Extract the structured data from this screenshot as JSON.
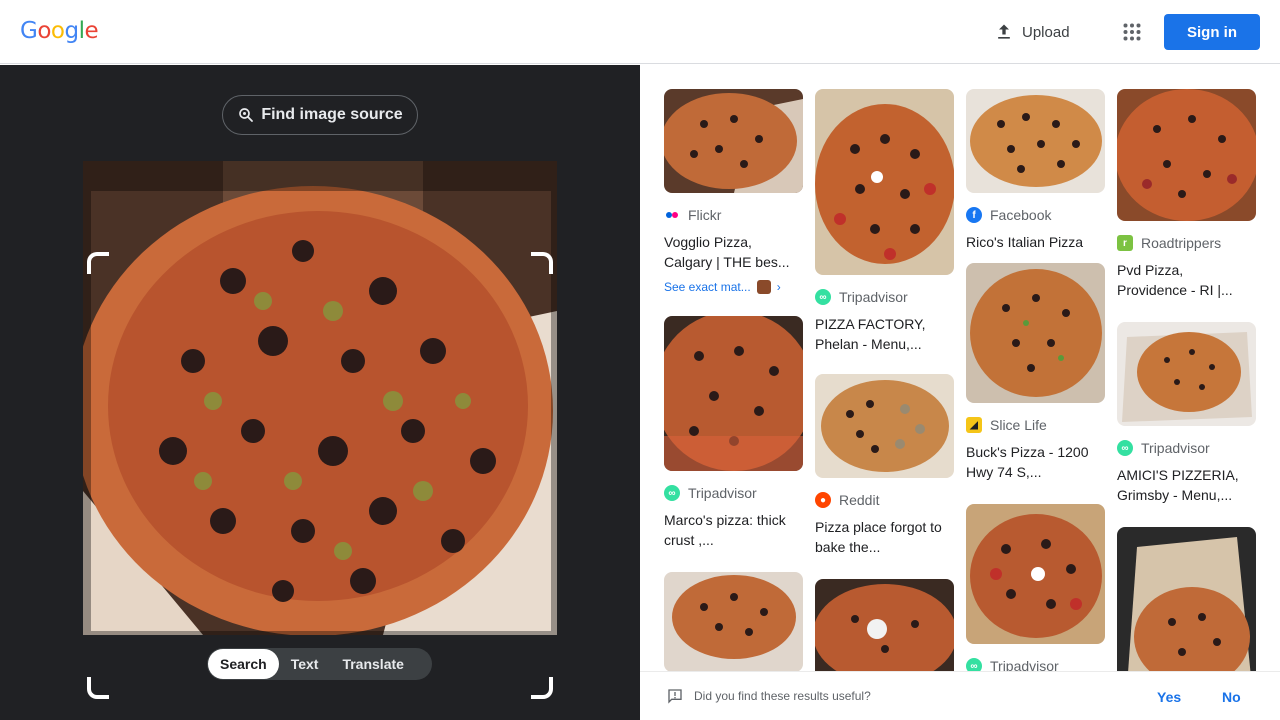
{
  "header": {
    "logo_letters": [
      {
        "ch": "G",
        "color": "#4285F4"
      },
      {
        "ch": "o",
        "color": "#EA4335"
      },
      {
        "ch": "o",
        "color": "#FBBC05"
      },
      {
        "ch": "g",
        "color": "#4285F4"
      },
      {
        "ch": "l",
        "color": "#34A853"
      },
      {
        "ch": "e",
        "color": "#EA4335"
      }
    ],
    "upload_label": "Upload",
    "apps_icon": "apps-grid-icon",
    "signin_label": "Sign in"
  },
  "lens": {
    "find_source_label": "Find image source",
    "modes": [
      "Search",
      "Text",
      "Translate"
    ],
    "active_mode": "Search"
  },
  "results": {
    "col1": [
      {
        "source": "Flickr",
        "title": "Vogglio Pizza, Calgary | THE bes...",
        "exact": "See exact mat...",
        "favicon": "flickr-icon"
      },
      {
        "source": "Tripadvisor",
        "title": "Marco's pizza: thick crust ,...",
        "favicon": "tripadvisor-icon"
      },
      {
        "source": "",
        "title": ""
      }
    ],
    "col2": [
      {
        "source": "Tripadvisor",
        "title": "PIZZA FACTORY, Phelan - Menu,...",
        "favicon": "tripadvisor-icon"
      },
      {
        "source": "Reddit",
        "title": "Pizza place forgot to bake the...",
        "favicon": "reddit-icon"
      },
      {
        "source": "",
        "title": ""
      }
    ],
    "col3": [
      {
        "source": "Facebook",
        "title": "Rico's Italian Pizza",
        "favicon": "facebook-icon"
      },
      {
        "source": "Slice Life",
        "title": "Buck's Pizza - 1200 Hwy 74 S,...",
        "favicon": "slice-icon"
      },
      {
        "source": "Tripadvisor",
        "title": "",
        "favicon": "tripadvisor-icon"
      }
    ],
    "col4": [
      {
        "source": "Roadtrippers",
        "title": "Pvd Pizza, Providence - RI |...",
        "favicon": "roadtrippers-icon"
      },
      {
        "source": "Tripadvisor",
        "title": "AMICI'S PIZZERIA, Grimsby - Menu,...",
        "favicon": "tripadvisor-icon"
      },
      {
        "source": "",
        "title": ""
      }
    ]
  },
  "feedback": {
    "question": "Did you find these results useful?",
    "yes": "Yes",
    "no": "No"
  },
  "colors": {
    "accent": "#1a73e8",
    "dark_panel": "#202124",
    "tripadvisor": "#34e0a1",
    "reddit": "#ff4500",
    "facebook": "#1877f2",
    "slice": "#f5c518",
    "roadtrippers": "#7cc242"
  }
}
